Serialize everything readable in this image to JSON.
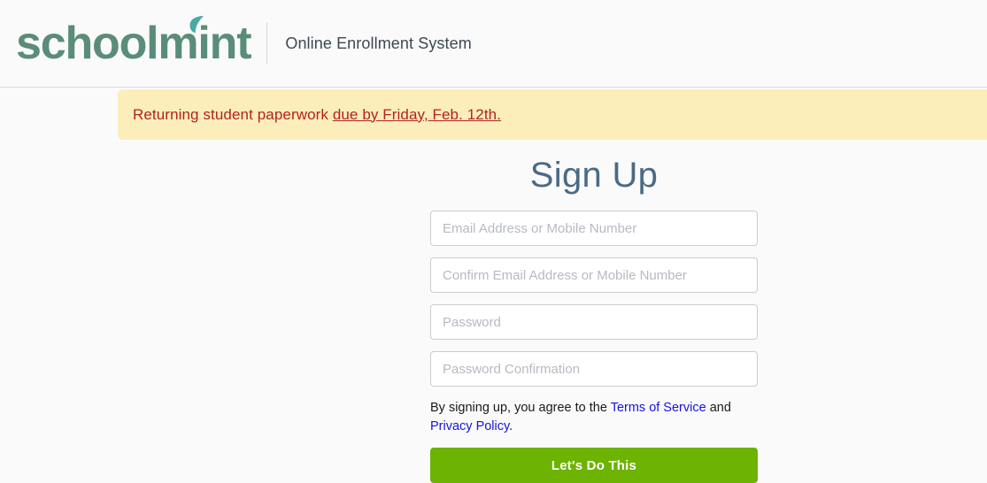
{
  "header": {
    "logo_text": "schoolmint",
    "logo_color": "#5a8d79",
    "leaf_color": "#49a9a4",
    "leaf_icon_name": "leaf-icon",
    "tagline": "Online Enrollment System"
  },
  "alert": {
    "message_plain": "Returning student paperwork ",
    "message_underlined": "due by Friday, Feb. 12th.",
    "background_color": "#fceeba",
    "text_color": "#b52121"
  },
  "signup": {
    "title": "Sign Up",
    "title_color": "#4a6a85",
    "fields": [
      {
        "name": "email",
        "placeholder": "Email Address or Mobile Number",
        "value": "",
        "type": "text"
      },
      {
        "name": "email-confirmation",
        "placeholder": "Confirm Email Address or Mobile Number",
        "value": "",
        "type": "text"
      },
      {
        "name": "password",
        "placeholder": "Password",
        "value": "",
        "type": "password"
      },
      {
        "name": "password-confirmation",
        "placeholder": "Password Confirmation",
        "value": "",
        "type": "password"
      }
    ],
    "terms": {
      "prefix": "By signing up, you agree to the ",
      "terms_link": "Terms of Service",
      "middle": " and ",
      "privacy_link": "Privacy Policy",
      "suffix": ".",
      "link_color": "#1414e0"
    },
    "submit_label": "Let's Do This",
    "submit_color": "#6cb302"
  }
}
